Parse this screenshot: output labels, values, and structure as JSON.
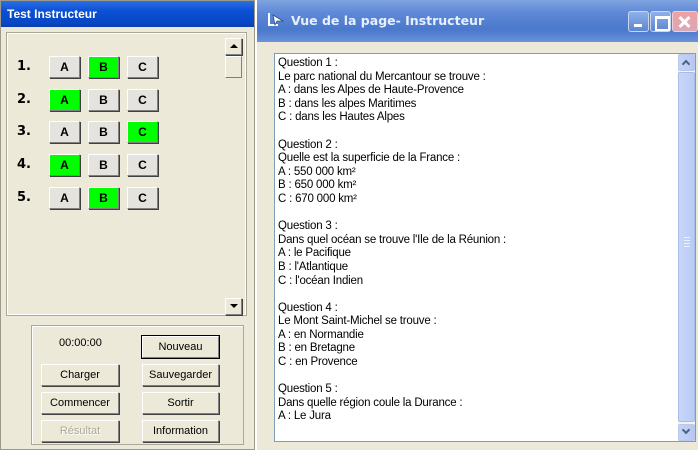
{
  "left_window": {
    "title": "Test Instructeur",
    "questions": [
      {
        "number": "1.",
        "options": [
          "A",
          "B",
          "C"
        ],
        "selected": "B"
      },
      {
        "number": "2.",
        "options": [
          "A",
          "B",
          "C"
        ],
        "selected": "A"
      },
      {
        "number": "3.",
        "options": [
          "A",
          "B",
          "C"
        ],
        "selected": "C"
      },
      {
        "number": "4.",
        "options": [
          "A",
          "B",
          "C"
        ],
        "selected": "A"
      },
      {
        "number": "5.",
        "options": [
          "A",
          "B",
          "C"
        ],
        "selected": "B"
      }
    ],
    "selected_color": "#00ff00",
    "controls": {
      "timer": "00:00:00",
      "nouveau": "Nouveau",
      "charger": "Charger",
      "sauvegarder": "Sauvegarder",
      "commencer": "Commencer",
      "sortir": "Sortir",
      "resultat": "Résultat",
      "information": "Information"
    }
  },
  "right_window": {
    "title": "Vue de la page- Instructeur",
    "icons": {
      "app": "page-view-icon",
      "minimize": "minimize-icon",
      "maximize": "maximize-icon",
      "close": "close-icon"
    },
    "content": [
      {
        "lines": [
          "Question 1 :",
          "Le parc national du Mercantour se trouve :",
          "A : dans les Alpes de Haute-Provence",
          "B : dans les alpes Maritimes",
          "C : dans les Hautes Alpes"
        ]
      },
      {
        "lines": [
          "Question 2 :",
          "Quelle est la superficie de la France :",
          "A : 550 000 km²",
          "B : 650 000 km²",
          "C : 670 000 km²"
        ]
      },
      {
        "lines": [
          "Question 3 :",
          "Dans quel océan se trouve l'Ile de la Réunion :",
          "A : le Pacifique",
          "B : l'Atlantique",
          "C : l'océan Indien"
        ]
      },
      {
        "lines": [
          "Question 4 :",
          "Le Mont Saint-Michel se trouve :",
          "A : en Normandie",
          "B : en Bretagne",
          "C : en Provence"
        ]
      },
      {
        "lines": [
          "Question 5 :",
          "Dans quelle région coule la Durance :",
          "A : Le Jura"
        ]
      }
    ]
  }
}
